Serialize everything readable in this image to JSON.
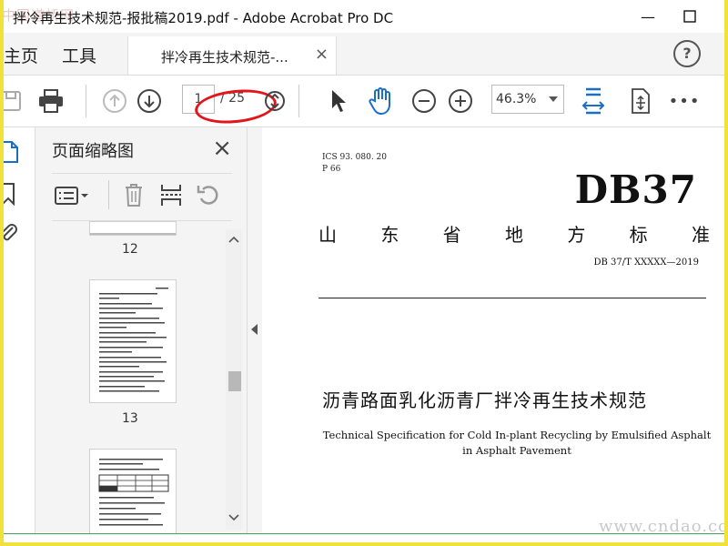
{
  "window": {
    "title": "拌冷再生技术规范-报批稿2019.pdf - Adobe Acrobat Pro DC",
    "minimize": "—",
    "maximize": "☐"
  },
  "watermarks": {
    "top_left": "中国道桥网",
    "bottom_right": "www.cndao.com"
  },
  "menu": {
    "home": "主页",
    "tools": "工具",
    "doc_tab": "拌冷再生技术规范-...",
    "doc_tab_close": "×",
    "help": "?"
  },
  "toolbar": {
    "page_current": "1",
    "page_total": "/ 25",
    "zoom": "46.3%",
    "more": "•••"
  },
  "thumbnails": {
    "title": "页面缩略图",
    "close": "×",
    "pages": [
      {
        "label": "12"
      },
      {
        "label": "13"
      }
    ]
  },
  "document": {
    "ics": "ICS   93. 080. 20",
    "p_code": "P  66",
    "db_code": "DB37",
    "standard_type_chars": [
      "山",
      "东",
      "省",
      "地",
      "方",
      "标",
      "准"
    ],
    "std_number": "DB 37/T  XXXXX—2019",
    "title_zh": "沥青路面乳化沥青厂拌冷再生技术规范",
    "title_en": "Technical Specification for Cold In-plant Recycling by Emulsified Asphalt in Asphalt Pavement"
  },
  "colors": {
    "accent_blue": "#1a6fc4",
    "annotation_red": "#e3151a",
    "outer_border": "#f0e23a"
  }
}
